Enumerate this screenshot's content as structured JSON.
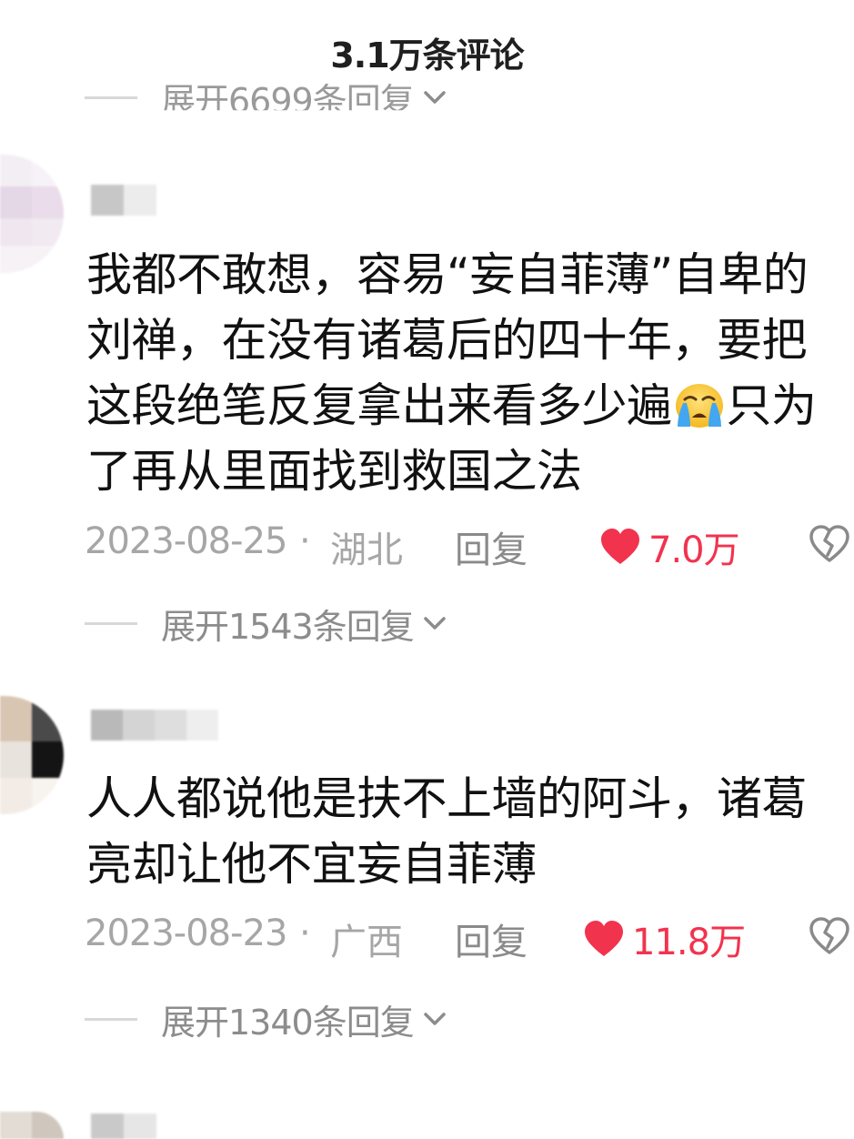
{
  "header": {
    "title": "3.1万条评论"
  },
  "top_expand": {
    "label": "展开6699条回复"
  },
  "comments": [
    {
      "text": "我都不敢想，容易“妄自菲薄”自卑的刘禅，在没有诸葛后的四十年，要把这段绝笔反复拿出来看多少遍",
      "text_after_emoji": "只为了再从里面找到救国之法",
      "emoji": "loudly-crying-face",
      "date": "2023-08-25",
      "separator": "·",
      "region": "湖北",
      "reply_label": "回复",
      "likes": "7.0万",
      "expand_label": "展开1543条回复"
    },
    {
      "text": "人人都说他是扶不上墙的阿斗，诸葛亮却让他不宜妄自菲薄",
      "date": "2023-08-23",
      "separator": "·",
      "region": "广西",
      "reply_label": "回复",
      "likes": "11.8万",
      "expand_label": "展开1340条回复"
    }
  ],
  "colors": {
    "like_red": "#f2334e",
    "meta_gray": "#a6a6a6",
    "text": "#111111"
  },
  "icons": [
    "chevron-down-icon",
    "heart-icon",
    "dislike-icon",
    "loudly-crying-emoji"
  ]
}
